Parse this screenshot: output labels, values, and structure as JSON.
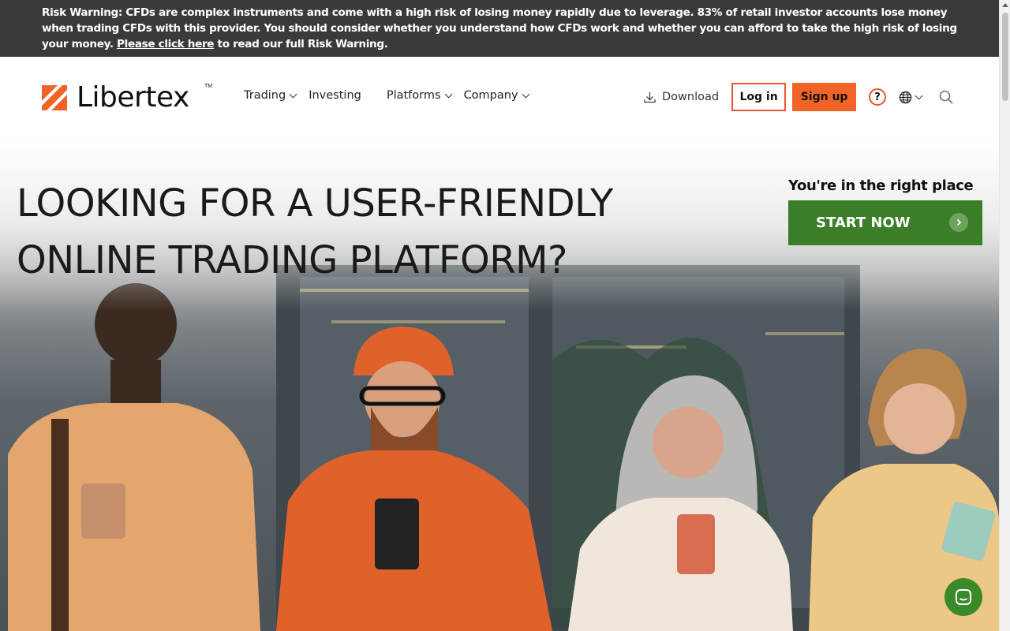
{
  "risk_banner": {
    "text_before": "Risk Warning: CFDs are complex instruments and come with a high risk of losing money rapidly due to leverage. 83% of retail investor accounts lose money when trading CFDs with this provider. You should consider whether you understand how CFDs work and whether you can afford to take the high risk of losing your money. ",
    "link": "Please click here",
    "text_after": " to read our full Risk Warning."
  },
  "header": {
    "logo": "Libertex",
    "logo_tm": "TM",
    "nav": [
      "Trading",
      "Investing",
      "Platforms",
      "Company"
    ],
    "download": "Download",
    "login": "Log in",
    "signup": "Sign up",
    "help": "?"
  },
  "hero": {
    "title_line1": "LOOKING FOR A USER-FRIENDLY",
    "title_line2": "ONLINE TRADING PLATFORM?",
    "cta_sub": "You're in the right place",
    "cta_button": "START NOW"
  },
  "colors": {
    "accent": "#f26328",
    "cta": "#3b7d28",
    "banner": "#3a3a3a"
  }
}
